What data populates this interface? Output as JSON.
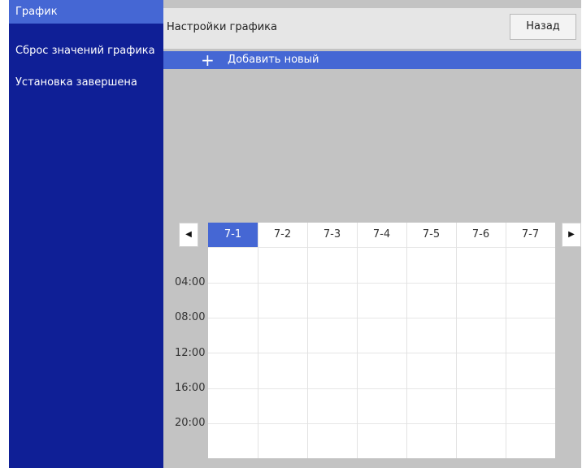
{
  "sidebar": {
    "items": [
      {
        "label": "График",
        "active": true
      },
      {
        "label": "Сброс значений графика",
        "active": false
      },
      {
        "label": "Установка завершена",
        "active": false
      }
    ]
  },
  "header": {
    "title": "Настройки графика",
    "back_label": "Назад"
  },
  "add_new": {
    "icon": "plus-icon",
    "label": "Добавить новый"
  },
  "schedule": {
    "prev_icon": "◀",
    "next_icon": "▶",
    "columns": [
      "7-1",
      "7-2",
      "7-3",
      "7-4",
      "7-5",
      "7-6",
      "7-7"
    ],
    "selected_column": "7-1",
    "times": [
      "04:00",
      "08:00",
      "12:00",
      "16:00",
      "20:00"
    ]
  },
  "colors": {
    "sidebar_bg": "#0f1f96",
    "accent": "#4567d4",
    "panel_bg": "#c3c3c3",
    "header_bg": "#e6e6e6"
  }
}
